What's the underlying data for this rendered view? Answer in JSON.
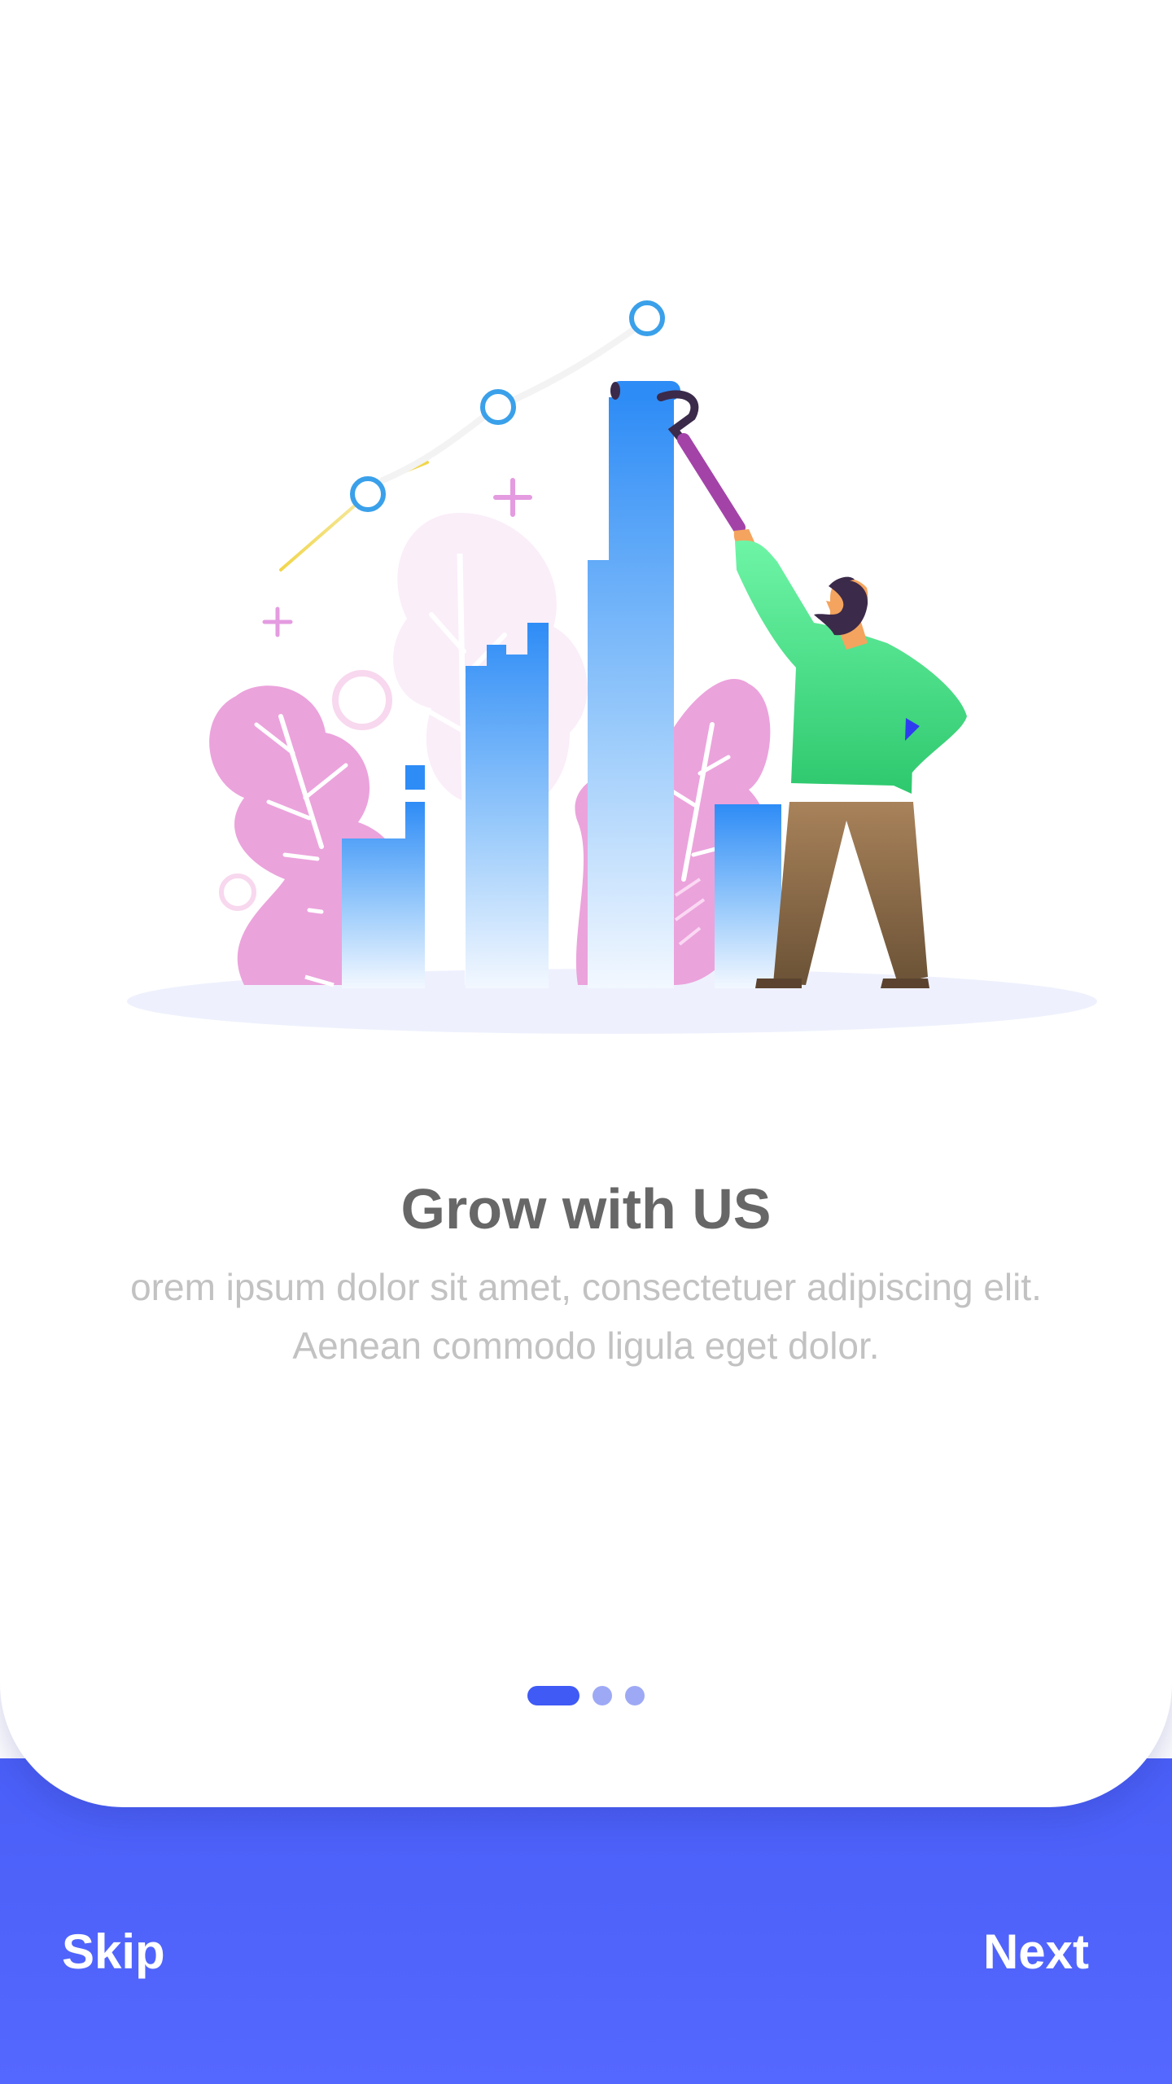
{
  "onboarding": {
    "illustration_icon": "growth-chart-illustration",
    "title": "Grow with US",
    "description": "orem ipsum dolor sit amet, consectetuer adipiscing elit. Aenean commodo ligula eget dolor.",
    "pager": {
      "total_pages": 3,
      "current_page": 1
    }
  },
  "footer": {
    "skip_label": "Skip",
    "next_label": "Next"
  },
  "colors": {
    "accent": "#4f63ff",
    "title_text": "#676767",
    "description_text": "#c2c2c2",
    "pager_active": "#3f5af5",
    "pager_inactive": "#9ea9f5",
    "chart_bar": "#2f8ff5",
    "tree": "#e99fdc",
    "person_shirt": "#3fdd82"
  }
}
